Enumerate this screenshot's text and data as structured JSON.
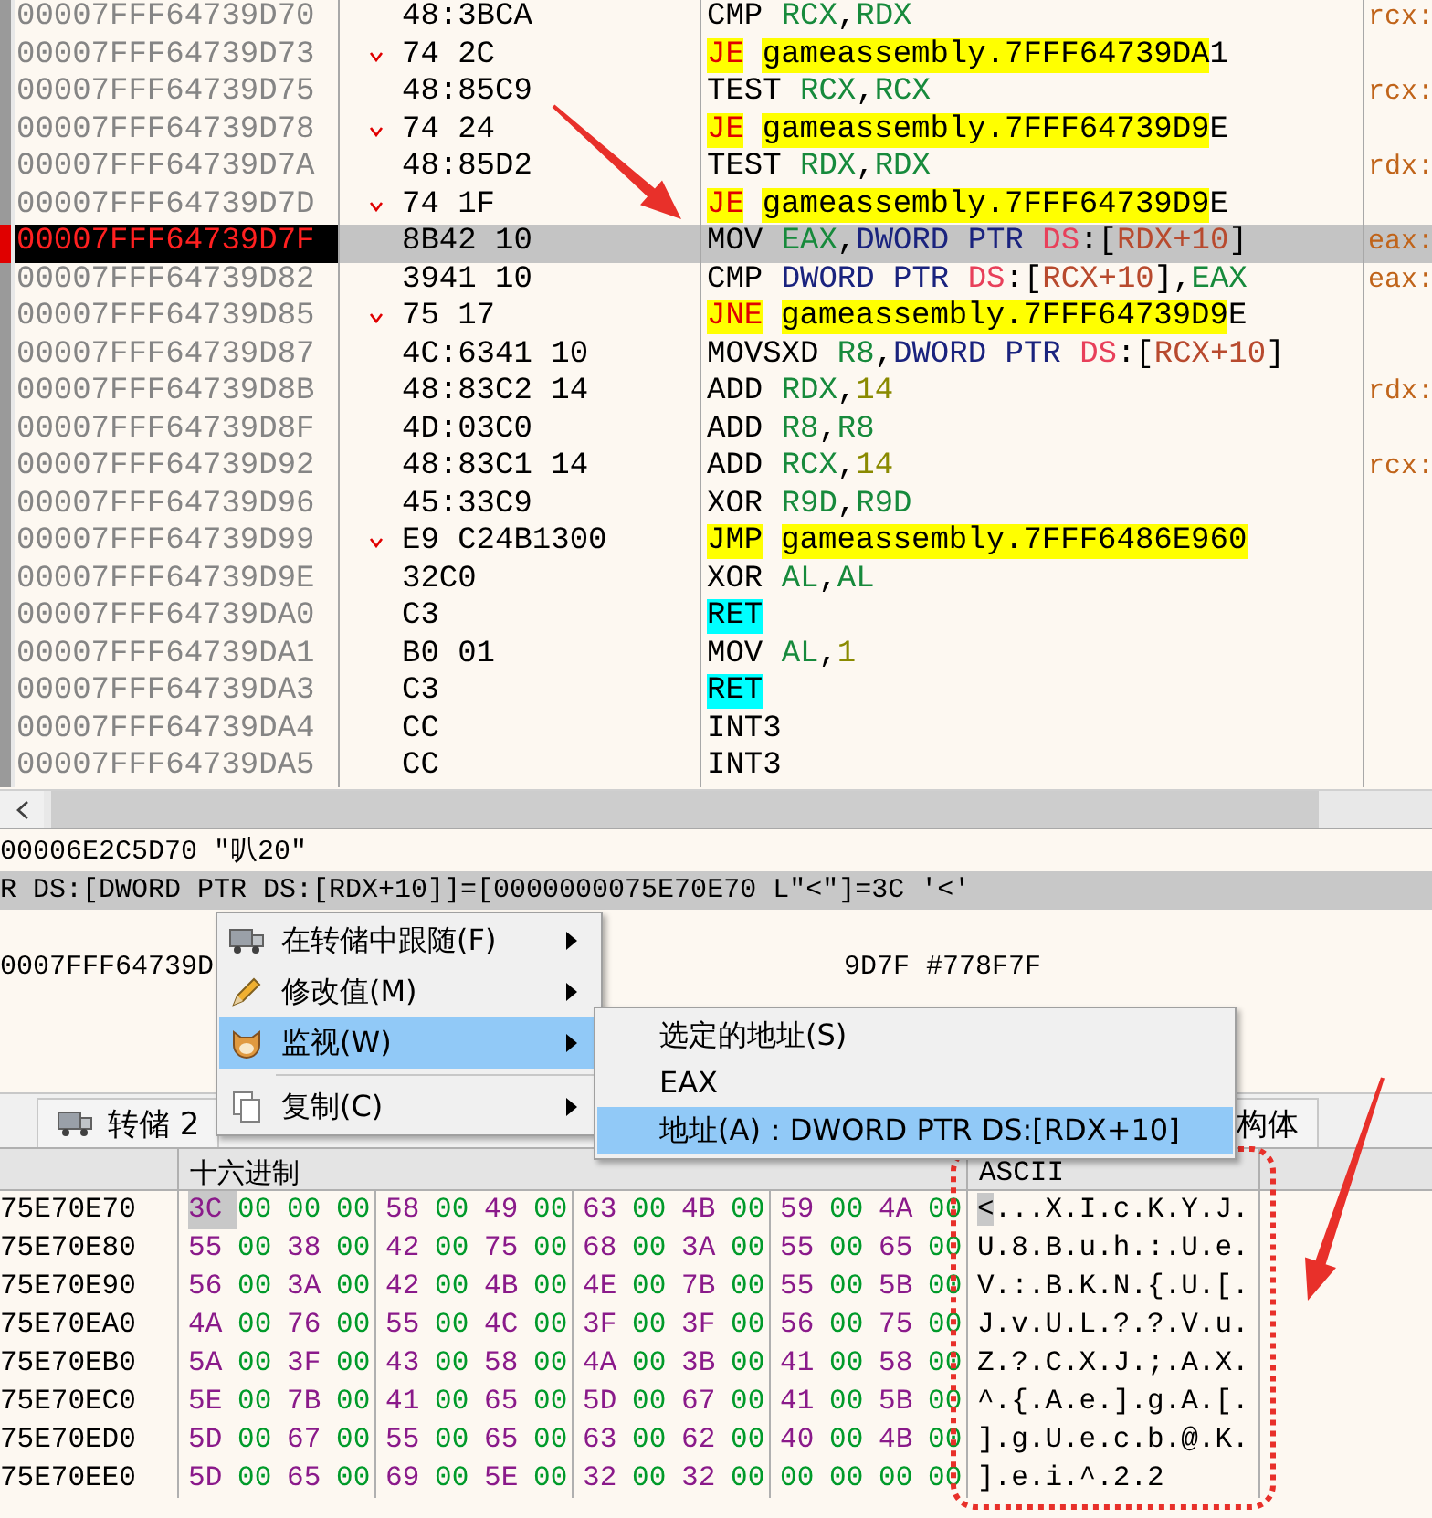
{
  "disassembly": {
    "rows": [
      {
        "address": "00007FFF64739D70",
        "bytes": "48:3BCA",
        "jump": false,
        "selected": false,
        "instruction": [
          {
            "text": "CMP ",
            "kind": "mnem"
          },
          {
            "text": "RCX",
            "kind": "reg"
          },
          {
            "text": ",",
            "kind": "plain"
          },
          {
            "text": "RDX",
            "kind": "reg"
          }
        ],
        "comment": "rcx:"
      },
      {
        "address": "00007FFF64739D73",
        "bytes": "74 2C",
        "jump": true,
        "selected": false,
        "instruction": [
          {
            "text": "JE",
            "kind": "jcc"
          },
          {
            "text": "gameassembly.7FFF64739DA",
            "kind": "target"
          },
          {
            "text": "1",
            "kind": "plain"
          }
        ]
      },
      {
        "address": "00007FFF64739D75",
        "bytes": "48:85C9",
        "jump": false,
        "selected": false,
        "instruction": [
          {
            "text": "TEST ",
            "kind": "mnem"
          },
          {
            "text": "RCX",
            "kind": "reg"
          },
          {
            "text": ",",
            "kind": "plain"
          },
          {
            "text": "RCX",
            "kind": "reg"
          }
        ],
        "comment": "rcx:"
      },
      {
        "address": "00007FFF64739D78",
        "bytes": "74 24",
        "jump": true,
        "selected": false,
        "instruction": [
          {
            "text": "JE",
            "kind": "jcc"
          },
          {
            "text": "gameassembly.7FFF64739D9",
            "kind": "target"
          },
          {
            "text": "E",
            "kind": "plain"
          }
        ]
      },
      {
        "address": "00007FFF64739D7A",
        "bytes": "48:85D2",
        "jump": false,
        "selected": false,
        "instruction": [
          {
            "text": "TEST ",
            "kind": "mnem"
          },
          {
            "text": "RDX",
            "kind": "reg"
          },
          {
            "text": ",",
            "kind": "plain"
          },
          {
            "text": "RDX",
            "kind": "reg"
          }
        ],
        "comment": "rdx:"
      },
      {
        "address": "00007FFF64739D7D",
        "bytes": "74 1F",
        "jump": true,
        "selected": false,
        "instruction": [
          {
            "text": "JE",
            "kind": "jcc"
          },
          {
            "text": "gameassembly.7FFF64739D9",
            "kind": "target"
          },
          {
            "text": "E",
            "kind": "plain"
          }
        ]
      },
      {
        "address": "00007FFF64739D7F",
        "bytes": "8B42 10",
        "jump": false,
        "selected": true,
        "instruction": [
          {
            "text": "MOV ",
            "kind": "mnem"
          },
          {
            "text": "EAX",
            "kind": "reg"
          },
          {
            "text": ",",
            "kind": "plain"
          },
          {
            "text": "DWORD PTR ",
            "kind": "size"
          },
          {
            "text": "DS",
            "kind": "seg"
          },
          {
            "text": ":[",
            "kind": "plain"
          },
          {
            "text": "RDX+10",
            "kind": "addr"
          },
          {
            "text": "]",
            "kind": "plain"
          }
        ],
        "comment": "eax:"
      },
      {
        "address": "00007FFF64739D82",
        "bytes": "3941 10",
        "jump": false,
        "selected": false,
        "instruction": [
          {
            "text": "CMP ",
            "kind": "mnem"
          },
          {
            "text": "DWORD PTR ",
            "kind": "size"
          },
          {
            "text": "DS",
            "kind": "seg"
          },
          {
            "text": ":[",
            "kind": "plain"
          },
          {
            "text": "RCX+10",
            "kind": "addr"
          },
          {
            "text": "],",
            "kind": "plain"
          },
          {
            "text": "EAX",
            "kind": "reg"
          }
        ],
        "comment": "eax:"
      },
      {
        "address": "00007FFF64739D85",
        "bytes": "75 17",
        "jump": true,
        "selected": false,
        "instruction": [
          {
            "text": "JNE",
            "kind": "jcc"
          },
          {
            "text": "gameassembly.7FFF64739D9",
            "kind": "target"
          },
          {
            "text": "E",
            "kind": "plain"
          }
        ]
      },
      {
        "address": "00007FFF64739D87",
        "bytes": "4C:6341 10",
        "jump": false,
        "selected": false,
        "instruction": [
          {
            "text": "MOVSXD ",
            "kind": "mnem"
          },
          {
            "text": "R8",
            "kind": "reg"
          },
          {
            "text": ",",
            "kind": "plain"
          },
          {
            "text": "DWORD PTR ",
            "kind": "size"
          },
          {
            "text": "DS",
            "kind": "seg"
          },
          {
            "text": ":[",
            "kind": "plain"
          },
          {
            "text": "RCX+10",
            "kind": "addr"
          },
          {
            "text": "]",
            "kind": "plain"
          }
        ]
      },
      {
        "address": "00007FFF64739D8B",
        "bytes": "48:83C2 14",
        "jump": false,
        "selected": false,
        "instruction": [
          {
            "text": "ADD ",
            "kind": "mnem"
          },
          {
            "text": "RDX",
            "kind": "reg"
          },
          {
            "text": ",",
            "kind": "plain"
          },
          {
            "text": "14",
            "kind": "num"
          }
        ],
        "comment": "rdx:"
      },
      {
        "address": "00007FFF64739D8F",
        "bytes": "4D:03C0",
        "jump": false,
        "selected": false,
        "instruction": [
          {
            "text": "ADD ",
            "kind": "mnem"
          },
          {
            "text": "R8",
            "kind": "reg"
          },
          {
            "text": ",",
            "kind": "plain"
          },
          {
            "text": "R8",
            "kind": "reg"
          }
        ]
      },
      {
        "address": "00007FFF64739D92",
        "bytes": "48:83C1 14",
        "jump": false,
        "selected": false,
        "instruction": [
          {
            "text": "ADD ",
            "kind": "mnem"
          },
          {
            "text": "RCX",
            "kind": "reg"
          },
          {
            "text": ",",
            "kind": "plain"
          },
          {
            "text": "14",
            "kind": "num"
          }
        ],
        "comment": "rcx:"
      },
      {
        "address": "00007FFF64739D96",
        "bytes": "45:33C9",
        "jump": false,
        "selected": false,
        "instruction": [
          {
            "text": "XOR ",
            "kind": "mnem"
          },
          {
            "text": "R9D",
            "kind": "reg"
          },
          {
            "text": ",",
            "kind": "plain"
          },
          {
            "text": "R9D",
            "kind": "reg"
          }
        ]
      },
      {
        "address": "00007FFF64739D99",
        "bytes": "E9 C24B1300",
        "jump": true,
        "selected": false,
        "instruction": [
          {
            "text": "JMP",
            "kind": "jmp"
          },
          {
            "text": "gameassembly.7FFF6486E960",
            "kind": "target"
          }
        ]
      },
      {
        "address": "00007FFF64739D9E",
        "bytes": "32C0",
        "jump": false,
        "selected": false,
        "instruction": [
          {
            "text": "XOR ",
            "kind": "mnem"
          },
          {
            "text": "AL",
            "kind": "reg"
          },
          {
            "text": ",",
            "kind": "plain"
          },
          {
            "text": "AL",
            "kind": "reg"
          }
        ]
      },
      {
        "address": "00007FFF64739DA0",
        "bytes": "C3",
        "jump": false,
        "selected": false,
        "instruction": [
          {
            "text": "RET",
            "kind": "ret"
          }
        ]
      },
      {
        "address": "00007FFF64739DA1",
        "bytes": "B0 01",
        "jump": false,
        "selected": false,
        "instruction": [
          {
            "text": "MOV ",
            "kind": "mnem"
          },
          {
            "text": "AL",
            "kind": "reg"
          },
          {
            "text": ",",
            "kind": "plain"
          },
          {
            "text": "1",
            "kind": "num"
          }
        ]
      },
      {
        "address": "00007FFF64739DA3",
        "bytes": "C3",
        "jump": false,
        "selected": false,
        "instruction": [
          {
            "text": "RET",
            "kind": "ret"
          }
        ]
      },
      {
        "address": "00007FFF64739DA4",
        "bytes": "CC",
        "jump": false,
        "selected": false,
        "instruction": [
          {
            "text": "INT3",
            "kind": "mnem"
          }
        ]
      },
      {
        "address": "00007FFF64739DA5",
        "bytes": "CC",
        "jump": false,
        "selected": false,
        "instruction": [
          {
            "text": "INT3",
            "kind": "mnem"
          }
        ]
      }
    ]
  },
  "info": {
    "lines": [
      {
        "text": "00006E2C5D70 \"叭20\"",
        "selected": false
      },
      {
        "text": "R DS:[DWORD PTR DS:[RDX+10]]=[0000000075E70E70 L\"<\"]=3C '<'",
        "selected": true
      }
    ],
    "address_line": {
      "text": "0007FFF64739D",
      "text_2": "9D7F #778F7F"
    }
  },
  "tabs": [
    {
      "label": "转储 2"
    },
    {
      "label": "构体"
    }
  ],
  "dump": {
    "columns": [
      "十六进制",
      "ASCII"
    ],
    "rows": [
      {
        "address": "75E70E70",
        "bytes": [
          "3C",
          "00",
          "00",
          "00",
          "58",
          "00",
          "49",
          "00",
          "63",
          "00",
          "4B",
          "00",
          "59",
          "00",
          "4A",
          "00"
        ],
        "ascii": "<...X.I.c.K.Y.J.",
        "cursor": true
      },
      {
        "address": "75E70E80",
        "bytes": [
          "55",
          "00",
          "38",
          "00",
          "42",
          "00",
          "75",
          "00",
          "68",
          "00",
          "3A",
          "00",
          "55",
          "00",
          "65",
          "00"
        ],
        "ascii": "U.8.B.u.h.:.U.e.",
        "cursor": false
      },
      {
        "address": "75E70E90",
        "bytes": [
          "56",
          "00",
          "3A",
          "00",
          "42",
          "00",
          "4B",
          "00",
          "4E",
          "00",
          "7B",
          "00",
          "55",
          "00",
          "5B",
          "00"
        ],
        "ascii": "V.:.B.K.N.{.U.[.",
        "cursor": false
      },
      {
        "address": "75E70EA0",
        "bytes": [
          "4A",
          "00",
          "76",
          "00",
          "55",
          "00",
          "4C",
          "00",
          "3F",
          "00",
          "3F",
          "00",
          "56",
          "00",
          "75",
          "00"
        ],
        "ascii": "J.v.U.L.?.?.V.u.",
        "cursor": false
      },
      {
        "address": "75E70EB0",
        "bytes": [
          "5A",
          "00",
          "3F",
          "00",
          "43",
          "00",
          "58",
          "00",
          "4A",
          "00",
          "3B",
          "00",
          "41",
          "00",
          "58",
          "00"
        ],
        "ascii": "Z.?.C.X.J.;.A.X.",
        "cursor": false
      },
      {
        "address": "75E70EC0",
        "bytes": [
          "5E",
          "00",
          "7B",
          "00",
          "41",
          "00",
          "65",
          "00",
          "5D",
          "00",
          "67",
          "00",
          "41",
          "00",
          "5B",
          "00"
        ],
        "ascii": "^.{.A.e.].g.A.[.",
        "cursor": false
      },
      {
        "address": "75E70ED0",
        "bytes": [
          "5D",
          "00",
          "67",
          "00",
          "55",
          "00",
          "65",
          "00",
          "63",
          "00",
          "62",
          "00",
          "40",
          "00",
          "4B",
          "00"
        ],
        "ascii": "].g.U.e.c.b.@.K.",
        "cursor": false
      },
      {
        "address": "75E70EE0",
        "bytes": [
          "5D",
          "00",
          "65",
          "00",
          "69",
          "00",
          "5E",
          "00",
          "32",
          "00",
          "32",
          "00",
          "00",
          "00",
          "00",
          "00"
        ],
        "ascii": "].e.i.^.2.2",
        "cursor": false
      }
    ]
  },
  "context_menu": {
    "items": [
      {
        "label": "在转储中跟随(F)",
        "submenu": true,
        "selected": false,
        "separator_before": false
      },
      {
        "label": "修改值(M)",
        "submenu": true,
        "selected": false,
        "separator_before": false
      },
      {
        "label": "监视(W)",
        "submenu": true,
        "selected": true,
        "separator_before": false
      },
      {
        "label": "复制(C)",
        "submenu": true,
        "selected": false,
        "separator_before": true
      }
    ]
  },
  "submenu": {
    "items": [
      {
        "label": "选定的地址(S)",
        "selected": false
      },
      {
        "label": "EAX",
        "selected": false
      },
      {
        "label": "地址(A)：DWORD PTR DS:[RDX+10]",
        "selected": true
      }
    ]
  }
}
